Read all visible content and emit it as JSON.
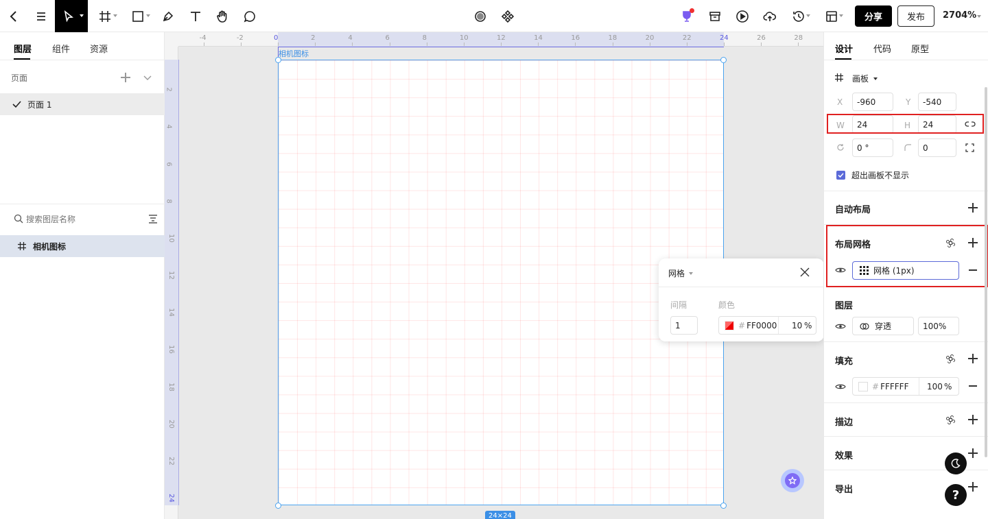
{
  "toolbar": {
    "share": "分享",
    "publish": "发布",
    "zoom": "2704%",
    "accent": "#000000"
  },
  "left": {
    "tabs": [
      "图层",
      "组件",
      "资源"
    ],
    "pages_label": "页面",
    "page_item": "页面 1",
    "search_placeholder": "搜索图层名称",
    "layer_item": "相机图标"
  },
  "canvas": {
    "board_name": "相机图标",
    "size_badge": "24×24",
    "hticks": [
      "-4",
      "-2",
      "0",
      "2",
      "4",
      "6",
      "8",
      "10",
      "12",
      "14",
      "16",
      "18",
      "20",
      "22",
      "24",
      "26",
      "28"
    ],
    "vticks": [
      "2",
      "4",
      "6",
      "8",
      "10",
      "12",
      "14",
      "16",
      "18",
      "20",
      "22",
      "24"
    ],
    "grid_color": "#FF0000"
  },
  "popup": {
    "title": "网格",
    "spacing_label": "间隔",
    "color_label": "颜色",
    "spacing_value": "1",
    "hash": "#",
    "color_value": "FF0000",
    "opacity": "10",
    "pct": "%"
  },
  "right": {
    "tabs": [
      "设计",
      "代码",
      "原型"
    ],
    "frame_label": "画板",
    "x_label": "X",
    "x_value": "-960",
    "y_label": "Y",
    "y_value": "-540",
    "w_label": "W",
    "w_value": "24",
    "h_label": "H",
    "h_value": "24",
    "rotation_value": "0 °",
    "radius_value": "0",
    "clip_label": "超出画板不显示",
    "auto_layout": "自动布局",
    "layout_grid": "布局网格",
    "grid_item": "网格 (1px)",
    "layer_section": "图层",
    "blend_mode": "穿透",
    "layer_opacity": "100",
    "fill_section": "填充",
    "fill_hash": "#",
    "fill_color": "FFFFFF",
    "fill_opacity": "100",
    "pct": "%",
    "stroke_section": "描边",
    "effect_section": "效果",
    "export_section": "导出"
  }
}
